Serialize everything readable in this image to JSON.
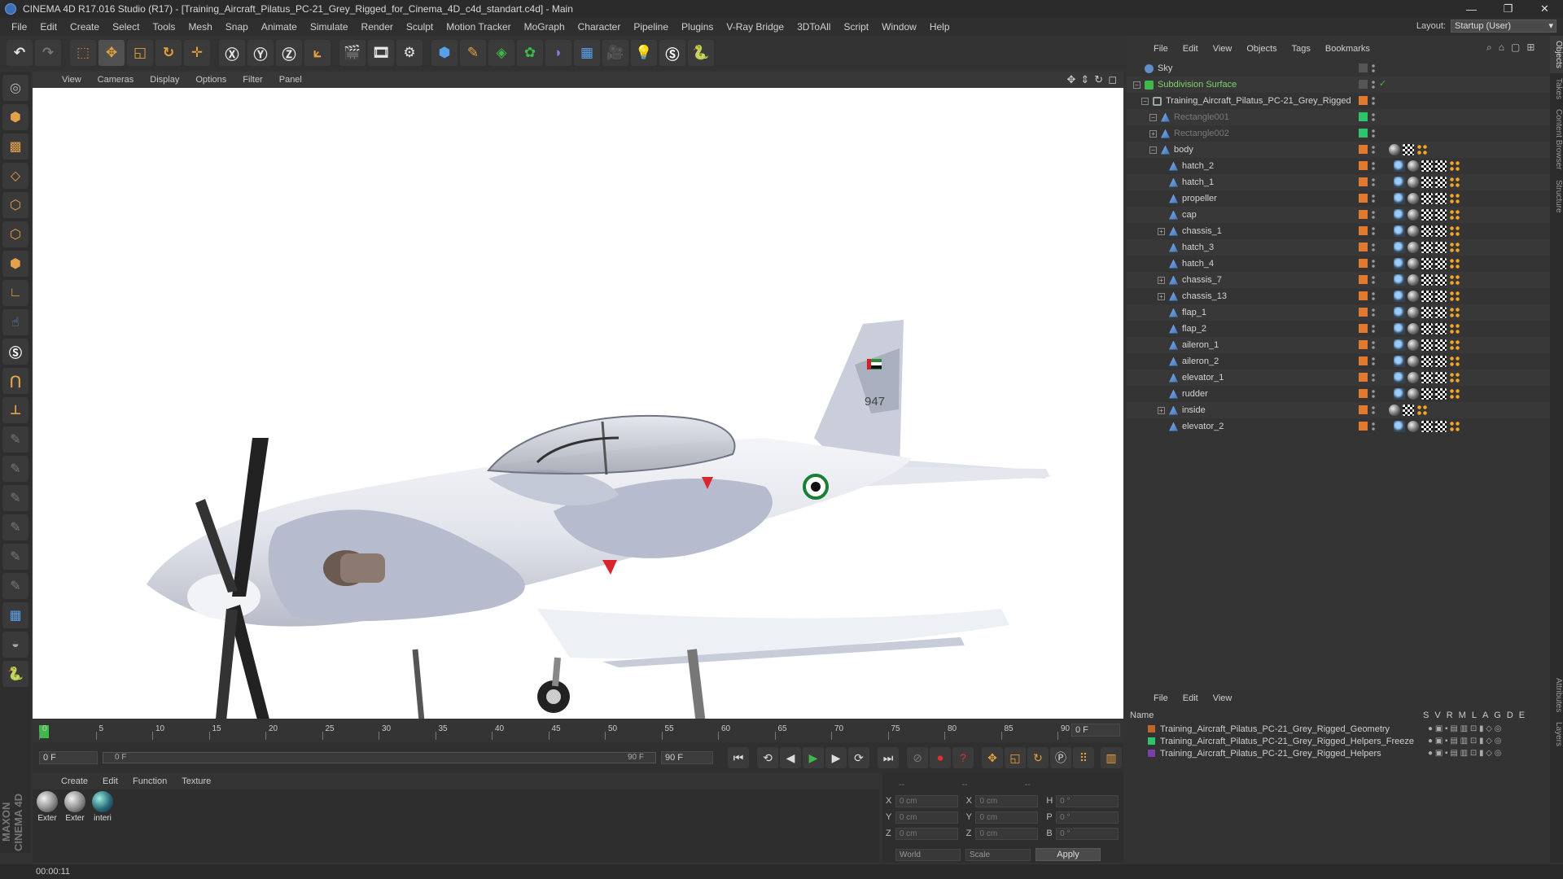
{
  "app": {
    "title": "CINEMA 4D R17.016 Studio (R17) - [Training_Aircraft_Pilatus_PC-21_Grey_Rigged_for_Cinema_4D_c4d_standart.c4d] - Main",
    "window_controls": [
      "—",
      "❐",
      "✕"
    ]
  },
  "menu": [
    "File",
    "Edit",
    "Create",
    "Select",
    "Tools",
    "Mesh",
    "Snap",
    "Animate",
    "Simulate",
    "Render",
    "Sculpt",
    "Motion Tracker",
    "MoGraph",
    "Character",
    "Pipeline",
    "Plugins",
    "V-Ray Bridge",
    "3DToAll",
    "Script",
    "Window",
    "Help"
  ],
  "layout": {
    "label": "Layout:",
    "value": "Startup (User)"
  },
  "viewport": {
    "menu": [
      "View",
      "Cameras",
      "Display",
      "Options",
      "Filter",
      "Panel"
    ]
  },
  "aircraft": {
    "tail_number": "947"
  },
  "timeline": {
    "ticks": [
      "0",
      "5",
      "10",
      "15",
      "20",
      "25",
      "30",
      "35",
      "40",
      "45",
      "50",
      "55",
      "60",
      "65",
      "70",
      "75",
      "80",
      "85",
      "90"
    ],
    "end_field": "0 F",
    "start_frame": "0 F",
    "range_start": "0 F",
    "range_end": "90 F",
    "end_frame": "90 F"
  },
  "materials": {
    "menu": [
      "Create",
      "Edit",
      "Function",
      "Texture"
    ],
    "items": [
      "Exter",
      "Exter",
      "interi"
    ]
  },
  "coordinates": {
    "rows": [
      {
        "a": "X",
        "av": "0 cm",
        "b": "X",
        "bv": "0 cm",
        "c": "H",
        "cv": "0 °"
      },
      {
        "a": "Y",
        "av": "0 cm",
        "b": "Y",
        "bv": "0 cm",
        "c": "P",
        "cv": "0 °"
      },
      {
        "a": "Z",
        "av": "0 cm",
        "b": "Z",
        "bv": "0 cm",
        "c": "B",
        "cv": "0 °"
      }
    ],
    "world": "World",
    "scale": "Scale",
    "apply": "Apply",
    "header": [
      "--",
      "--",
      "--"
    ]
  },
  "status": {
    "time": "00:00:11"
  },
  "object_manager": {
    "menu": [
      "File",
      "Edit",
      "View",
      "Objects",
      "Tags",
      "Bookmarks"
    ],
    "objects": [
      {
        "name": "Sky",
        "style": "normal",
        "icon": "sky"
      },
      {
        "name": "Subdivision Surface",
        "style": "grn",
        "icon": "sub"
      },
      {
        "name": "Training_Aircraft_Pilatus_PC-21_Grey_Rigged",
        "style": "normal",
        "icon": "null"
      },
      {
        "name": "Rectangle001",
        "style": "dim",
        "icon": "poly"
      },
      {
        "name": "Rectangle002",
        "style": "dim",
        "icon": "poly"
      },
      {
        "name": "body",
        "style": "normal",
        "icon": "poly"
      },
      {
        "name": "hatch_2",
        "style": "normal",
        "icon": "poly"
      },
      {
        "name": "hatch_1",
        "style": "normal",
        "icon": "poly"
      },
      {
        "name": "propeller",
        "style": "normal",
        "icon": "poly"
      },
      {
        "name": "cap",
        "style": "normal",
        "icon": "poly"
      },
      {
        "name": "chassis_1",
        "style": "normal",
        "icon": "poly"
      },
      {
        "name": "hatch_3",
        "style": "normal",
        "icon": "poly"
      },
      {
        "name": "hatch_4",
        "style": "normal",
        "icon": "poly"
      },
      {
        "name": "chassis_7",
        "style": "normal",
        "icon": "poly"
      },
      {
        "name": "chassis_13",
        "style": "normal",
        "icon": "poly"
      },
      {
        "name": "flap_1",
        "style": "normal",
        "icon": "poly"
      },
      {
        "name": "flap_2",
        "style": "normal",
        "icon": "poly"
      },
      {
        "name": "aileron_1",
        "style": "normal",
        "icon": "poly"
      },
      {
        "name": "aileron_2",
        "style": "normal",
        "icon": "poly"
      },
      {
        "name": "elevator_1",
        "style": "normal",
        "icon": "poly"
      },
      {
        "name": "rudder",
        "style": "normal",
        "icon": "poly"
      },
      {
        "name": "inside",
        "style": "normal",
        "icon": "poly"
      },
      {
        "name": "elevator_2",
        "style": "normal",
        "icon": "poly"
      }
    ]
  },
  "layer_manager": {
    "menu": [
      "File",
      "Edit",
      "View"
    ],
    "name_header": "Name",
    "columns": [
      "S",
      "V",
      "R",
      "M",
      "L",
      "A",
      "G",
      "D",
      "E"
    ],
    "layers": [
      {
        "name": "Training_Aircraft_Pilatus_PC-21_Grey_Rigged_Geometry",
        "color": "#c0652c"
      },
      {
        "name": "Training_Aircraft_Pilatus_PC-21_Grey_Rigged_Helpers_Freeze",
        "color": "#2fc46b"
      },
      {
        "name": "Training_Aircraft_Pilatus_PC-21_Grey_Rigged_Helpers",
        "color": "#7a3fa8"
      }
    ]
  },
  "right_tabs": [
    "Objects",
    "Takes",
    "Content Browser",
    "Structure",
    "Attributes",
    "Layers"
  ],
  "colors": {
    "accent_orange": "#e07a2e",
    "active_green": "#3fb94a",
    "bg": "#333333"
  }
}
